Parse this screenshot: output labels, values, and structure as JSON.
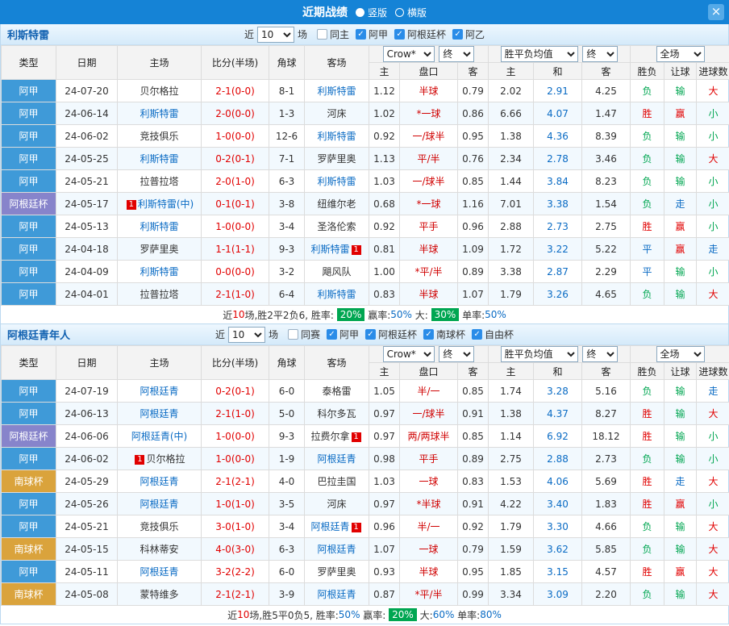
{
  "topbar": {
    "title": "近期战绩",
    "vertical_label": "竖版",
    "horizontal_label": "横版"
  },
  "icons": {
    "close": "×",
    "check": "✓",
    "card_badge": "1"
  },
  "labels": {
    "near": "近",
    "games": "场"
  },
  "selects": {
    "games": "10",
    "company": "Crow*",
    "final": "终",
    "avg": "胜平负均值",
    "scope": "全场"
  },
  "columns": {
    "type": "类型",
    "date": "日期",
    "home": "主场",
    "score": "比分(半场)",
    "corner": "角球",
    "away": "客场",
    "asia_home": "主",
    "handicap": "盘口",
    "asia_away": "客",
    "eu_home": "主",
    "eu_draw": "和",
    "eu_away": "客",
    "winlose": "胜负",
    "letgoal": "让球",
    "goals": "进球数"
  },
  "result_colors": {
    "胜": "red",
    "负": "green",
    "平": "blue",
    "赢": "red",
    "输": "green",
    "走": "blue",
    "大": "red",
    "小": "green"
  },
  "sections": [
    {
      "team": "利斯特雷",
      "filters": [
        {
          "label": "同主",
          "checked": false
        },
        {
          "label": "阿甲",
          "checked": true
        },
        {
          "label": "阿根廷杯",
          "checked": true
        },
        {
          "label": "阿乙",
          "checked": true
        }
      ],
      "rows": [
        {
          "league": "阿甲",
          "lcls": "lg-blue",
          "date": "24-07-20",
          "home": {
            "name": "贝尔格拉"
          },
          "score": "2-1(0-0)",
          "corner": "8-1",
          "away": {
            "name": "利斯特雷",
            "focal": true
          },
          "asia": [
            "1.12",
            "半球",
            "0.79"
          ],
          "eu": [
            "2.02",
            "2.91",
            "4.25"
          ],
          "res": [
            "负",
            "输",
            "大"
          ]
        },
        {
          "league": "阿甲",
          "lcls": "lg-blue",
          "date": "24-06-14",
          "home": {
            "name": "利斯特雷",
            "focal": true
          },
          "score": "2-0(0-0)",
          "corner": "1-3",
          "away": {
            "name": "河床"
          },
          "asia": [
            "1.02",
            "*一球",
            "0.86"
          ],
          "eu": [
            "6.66",
            "4.07",
            "1.47"
          ],
          "res": [
            "胜",
            "赢",
            "小"
          ]
        },
        {
          "league": "阿甲",
          "lcls": "lg-blue",
          "date": "24-06-02",
          "home": {
            "name": "竞技俱乐"
          },
          "score": "1-0(0-0)",
          "corner": "12-6",
          "away": {
            "name": "利斯特雷",
            "focal": true
          },
          "asia": [
            "0.92",
            "一/球半",
            "0.95"
          ],
          "eu": [
            "1.38",
            "4.36",
            "8.39"
          ],
          "res": [
            "负",
            "输",
            "小"
          ]
        },
        {
          "league": "阿甲",
          "lcls": "lg-blue",
          "date": "24-05-25",
          "home": {
            "name": "利斯特雷",
            "focal": true
          },
          "score": "0-2(0-1)",
          "corner": "7-1",
          "away": {
            "name": "罗萨里奥"
          },
          "asia": [
            "1.13",
            "平/半",
            "0.76"
          ],
          "eu": [
            "2.34",
            "2.78",
            "3.46"
          ],
          "res": [
            "负",
            "输",
            "大"
          ]
        },
        {
          "league": "阿甲",
          "lcls": "lg-blue",
          "date": "24-05-21",
          "home": {
            "name": "拉普拉塔"
          },
          "score": "2-0(1-0)",
          "corner": "6-3",
          "away": {
            "name": "利斯特雷",
            "focal": true
          },
          "asia": [
            "1.03",
            "一/球半",
            "0.85"
          ],
          "eu": [
            "1.44",
            "3.84",
            "8.23"
          ],
          "res": [
            "负",
            "输",
            "小"
          ]
        },
        {
          "league": "阿根廷杯",
          "lcls": "lg-purple",
          "date": "24-05-17",
          "home": {
            "name": "利斯特雷(中)",
            "focal": true,
            "mark": "before"
          },
          "score": "0-1(0-1)",
          "corner": "3-8",
          "away": {
            "name": "纽维尔老"
          },
          "asia": [
            "0.68",
            "*一球",
            "1.16"
          ],
          "eu": [
            "7.01",
            "3.38",
            "1.54"
          ],
          "res": [
            "负",
            "走",
            "小"
          ]
        },
        {
          "league": "阿甲",
          "lcls": "lg-blue",
          "date": "24-05-13",
          "home": {
            "name": "利斯特雷",
            "focal": true
          },
          "score": "1-0(0-0)",
          "corner": "3-4",
          "away": {
            "name": "圣洛伦索"
          },
          "asia": [
            "0.92",
            "平手",
            "0.96"
          ],
          "eu": [
            "2.88",
            "2.73",
            "2.75"
          ],
          "res": [
            "胜",
            "赢",
            "小"
          ]
        },
        {
          "league": "阿甲",
          "lcls": "lg-blue",
          "date": "24-04-18",
          "home": {
            "name": "罗萨里奥"
          },
          "score": "1-1(1-1)",
          "corner": "9-3",
          "away": {
            "name": "利斯特雷",
            "focal": true,
            "mark": "after"
          },
          "asia": [
            "0.81",
            "半球",
            "1.09"
          ],
          "eu": [
            "1.72",
            "3.22",
            "5.22"
          ],
          "res": [
            "平",
            "赢",
            "走"
          ]
        },
        {
          "league": "阿甲",
          "lcls": "lg-blue",
          "date": "24-04-09",
          "home": {
            "name": "利斯特雷",
            "focal": true
          },
          "score": "0-0(0-0)",
          "corner": "3-2",
          "away": {
            "name": "飓风队"
          },
          "asia": [
            "1.00",
            "*平/半",
            "0.89"
          ],
          "eu": [
            "3.38",
            "2.87",
            "2.29"
          ],
          "res": [
            "平",
            "输",
            "小"
          ]
        },
        {
          "league": "阿甲",
          "lcls": "lg-blue",
          "date": "24-04-01",
          "home": {
            "name": "拉普拉塔"
          },
          "score": "2-1(1-0)",
          "corner": "6-4",
          "away": {
            "name": "利斯特雷",
            "focal": true
          },
          "asia": [
            "0.83",
            "半球",
            "1.07"
          ],
          "eu": [
            "1.79",
            "3.26",
            "4.65"
          ],
          "res": [
            "负",
            "输",
            "大"
          ]
        }
      ],
      "footer": [
        {
          "text": "近"
        },
        {
          "text": "10",
          "hl": "red"
        },
        {
          "text": "场,胜2平2负6, 胜率: "
        },
        {
          "text": "20%",
          "hl": "badge"
        },
        {
          "text": " 赢率:"
        },
        {
          "text": "50%",
          "hl": "blue"
        },
        {
          "text": " 大: "
        },
        {
          "text": "30%",
          "hl": "badge"
        },
        {
          "text": " 单率:"
        },
        {
          "text": "50%",
          "hl": "blue"
        }
      ]
    },
    {
      "team": "阿根廷青年人",
      "filters": [
        {
          "label": "同赛",
          "checked": false
        },
        {
          "label": "阿甲",
          "checked": true
        },
        {
          "label": "阿根廷杯",
          "checked": true
        },
        {
          "label": "南球杯",
          "checked": true
        },
        {
          "label": "自由杯",
          "checked": true
        }
      ],
      "rows": [
        {
          "league": "阿甲",
          "lcls": "lg-blue",
          "date": "24-07-19",
          "home": {
            "name": "阿根廷青",
            "focal": true
          },
          "score": "0-2(0-1)",
          "corner": "6-0",
          "away": {
            "name": "泰格雷"
          },
          "asia": [
            "1.05",
            "半/一",
            "0.85"
          ],
          "eu": [
            "1.74",
            "3.28",
            "5.16"
          ],
          "res": [
            "负",
            "输",
            "走"
          ]
        },
        {
          "league": "阿甲",
          "lcls": "lg-blue",
          "date": "24-06-13",
          "home": {
            "name": "阿根廷青",
            "focal": true
          },
          "score": "2-1(1-0)",
          "corner": "5-0",
          "away": {
            "name": "科尔多瓦"
          },
          "asia": [
            "0.97",
            "一/球半",
            "0.91"
          ],
          "eu": [
            "1.38",
            "4.37",
            "8.27"
          ],
          "res": [
            "胜",
            "输",
            "大"
          ]
        },
        {
          "league": "阿根廷杯",
          "lcls": "lg-purple",
          "date": "24-06-06",
          "home": {
            "name": "阿根廷青(中)",
            "focal": true
          },
          "score": "1-0(0-0)",
          "corner": "9-3",
          "away": {
            "name": "拉费尔拿",
            "mark": "after"
          },
          "asia": [
            "0.97",
            "两/两球半",
            "0.85"
          ],
          "eu": [
            "1.14",
            "6.92",
            "18.12"
          ],
          "res": [
            "胜",
            "输",
            "小"
          ]
        },
        {
          "league": "阿甲",
          "lcls": "lg-blue",
          "date": "24-06-02",
          "home": {
            "name": "贝尔格拉",
            "mark": "before"
          },
          "score": "1-0(0-0)",
          "corner": "1-9",
          "away": {
            "name": "阿根廷青",
            "focal": true
          },
          "asia": [
            "0.98",
            "平手",
            "0.89"
          ],
          "eu": [
            "2.75",
            "2.88",
            "2.73"
          ],
          "res": [
            "负",
            "输",
            "小"
          ]
        },
        {
          "league": "南球杯",
          "lcls": "lg-orange",
          "date": "24-05-29",
          "home": {
            "name": "阿根廷青",
            "focal": true
          },
          "score": "2-1(2-1)",
          "corner": "4-0",
          "away": {
            "name": "巴拉圭国"
          },
          "asia": [
            "1.03",
            "一球",
            "0.83"
          ],
          "eu": [
            "1.53",
            "4.06",
            "5.69"
          ],
          "res": [
            "胜",
            "走",
            "大"
          ]
        },
        {
          "league": "阿甲",
          "lcls": "lg-blue",
          "date": "24-05-26",
          "home": {
            "name": "阿根廷青",
            "focal": true
          },
          "score": "1-0(1-0)",
          "corner": "3-5",
          "away": {
            "name": "河床"
          },
          "asia": [
            "0.97",
            "*半球",
            "0.91"
          ],
          "eu": [
            "4.22",
            "3.40",
            "1.83"
          ],
          "res": [
            "胜",
            "赢",
            "小"
          ]
        },
        {
          "league": "阿甲",
          "lcls": "lg-blue",
          "date": "24-05-21",
          "home": {
            "name": "竞技俱乐"
          },
          "score": "3-0(1-0)",
          "corner": "3-4",
          "away": {
            "name": "阿根廷青",
            "focal": true,
            "mark": "after"
          },
          "asia": [
            "0.96",
            "半/一",
            "0.92"
          ],
          "eu": [
            "1.79",
            "3.30",
            "4.66"
          ],
          "res": [
            "负",
            "输",
            "大"
          ]
        },
        {
          "league": "南球杯",
          "lcls": "lg-orange",
          "date": "24-05-15",
          "home": {
            "name": "科林蒂安"
          },
          "score": "4-0(3-0)",
          "corner": "6-3",
          "away": {
            "name": "阿根廷青",
            "focal": true
          },
          "asia": [
            "1.07",
            "一球",
            "0.79"
          ],
          "eu": [
            "1.59",
            "3.62",
            "5.85"
          ],
          "res": [
            "负",
            "输",
            "大"
          ]
        },
        {
          "league": "阿甲",
          "lcls": "lg-blue",
          "date": "24-05-11",
          "home": {
            "name": "阿根廷青",
            "focal": true
          },
          "score": "3-2(2-2)",
          "corner": "6-0",
          "away": {
            "name": "罗萨里奥"
          },
          "asia": [
            "0.93",
            "半球",
            "0.95"
          ],
          "eu": [
            "1.85",
            "3.15",
            "4.57"
          ],
          "res": [
            "胜",
            "赢",
            "大"
          ]
        },
        {
          "league": "南球杯",
          "lcls": "lg-orange",
          "date": "24-05-08",
          "home": {
            "name": "蒙特维多"
          },
          "score": "2-1(2-1)",
          "corner": "3-9",
          "away": {
            "name": "阿根廷青",
            "focal": true
          },
          "asia": [
            "0.87",
            "*平/半",
            "0.99"
          ],
          "eu": [
            "3.34",
            "3.09",
            "2.20"
          ],
          "res": [
            "负",
            "输",
            "大"
          ]
        }
      ],
      "footer": [
        {
          "text": "近"
        },
        {
          "text": "10",
          "hl": "red"
        },
        {
          "text": "场,胜5平0负5, 胜率:"
        },
        {
          "text": "50%",
          "hl": "blue"
        },
        {
          "text": " 赢率: "
        },
        {
          "text": "20%",
          "hl": "badge"
        },
        {
          "text": " 大:"
        },
        {
          "text": "60%",
          "hl": "blue"
        },
        {
          "text": " 单率:"
        },
        {
          "text": "80%",
          "hl": "blue"
        }
      ]
    }
  ]
}
